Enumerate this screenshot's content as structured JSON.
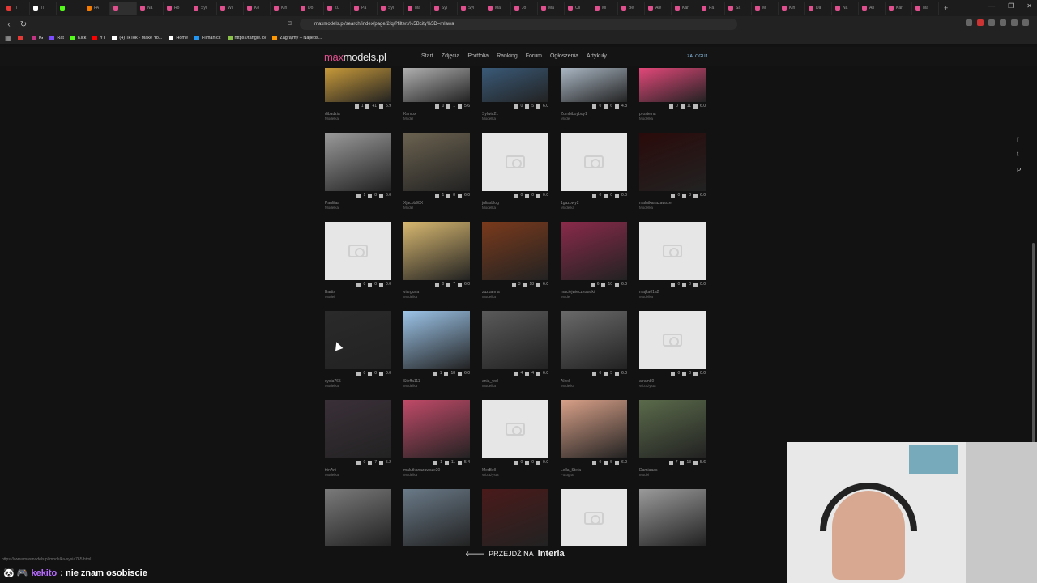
{
  "browser": {
    "tabs": [
      {
        "label": "Ti",
        "color": "#e53935"
      },
      {
        "label": "Ti",
        "color": "#ffffff"
      },
      {
        "label": "",
        "color": "#53fc18"
      },
      {
        "label": "FA",
        "color": "#f57c00"
      },
      {
        "label": "",
        "color": "#e04f8e",
        "active": true
      },
      {
        "label": "Na",
        "color": "#e04f8e"
      },
      {
        "label": "Ro",
        "color": "#e04f8e"
      },
      {
        "label": "Syl",
        "color": "#e04f8e"
      },
      {
        "label": "Wi",
        "color": "#e04f8e"
      },
      {
        "label": "Ko",
        "color": "#e04f8e"
      },
      {
        "label": "Kin",
        "color": "#e04f8e"
      },
      {
        "label": "Do",
        "color": "#e04f8e"
      },
      {
        "label": "Zu",
        "color": "#e04f8e"
      },
      {
        "label": "Pa",
        "color": "#e04f8e"
      },
      {
        "label": "Syl",
        "color": "#e04f8e"
      },
      {
        "label": "Ma",
        "color": "#e04f8e"
      },
      {
        "label": "Syl",
        "color": "#e04f8e"
      },
      {
        "label": "Syl",
        "color": "#e04f8e"
      },
      {
        "label": "Ma",
        "color": "#e04f8e"
      },
      {
        "label": "Jo",
        "color": "#e04f8e"
      },
      {
        "label": "Ma",
        "color": "#e04f8e"
      },
      {
        "label": "Oli",
        "color": "#e04f8e"
      },
      {
        "label": "Mi",
        "color": "#e04f8e"
      },
      {
        "label": "Be",
        "color": "#e04f8e"
      },
      {
        "label": "Ale",
        "color": "#e04f8e"
      },
      {
        "label": "Kar",
        "color": "#e04f8e"
      },
      {
        "label": "Pa",
        "color": "#e04f8e"
      },
      {
        "label": "Sa",
        "color": "#e04f8e"
      },
      {
        "label": "Mi",
        "color": "#e04f8e"
      },
      {
        "label": "Kin",
        "color": "#e04f8e"
      },
      {
        "label": "Da",
        "color": "#e04f8e"
      },
      {
        "label": "Na",
        "color": "#e04f8e"
      },
      {
        "label": "An",
        "color": "#e04f8e"
      },
      {
        "label": "Kar",
        "color": "#e04f8e"
      },
      {
        "label": "Ma",
        "color": "#e04f8e"
      }
    ],
    "new_tab": "+",
    "window_controls": [
      "—",
      "❐",
      "✕"
    ],
    "url": "maxmodels.pl/search/index/page/2/q/?filters%5Bcity%5D=mlawa",
    "bookmarks": [
      {
        "label": "",
        "color": "#e53935"
      },
      {
        "label": "IG",
        "color": "#c13584"
      },
      {
        "label": "Rat",
        "color": "#7c4dff"
      },
      {
        "label": "Kick",
        "color": "#53fc18"
      },
      {
        "label": "YT",
        "color": "#ff0000"
      },
      {
        "label": "(4)TikTok - Make Yo...",
        "color": "#ffffff"
      },
      {
        "label": "Home",
        "color": "#ffffff"
      },
      {
        "label": "Filman.cc",
        "color": "#2196f3"
      },
      {
        "label": "https://tangle.io/",
        "color": "#8bc34a"
      },
      {
        "label": "Zagrajmy – Najleps...",
        "color": "#ff9800"
      }
    ]
  },
  "site": {
    "logo_max": "max",
    "logo_rest": "models.pl",
    "menu": [
      "Start",
      "Zdjęcia",
      "Portfolia",
      "Ranking",
      "Forum",
      "Ogłoszenia",
      "Artykuły"
    ],
    "login": "ZALOGUJ"
  },
  "rows": [
    [
      {
        "name": "dibadzia",
        "role": "Modelka",
        "stats": [
          "1",
          "41",
          "5.9"
        ],
        "img": "#c89a3a"
      },
      {
        "name": "Kamox",
        "role": "Model",
        "stats": [
          "0",
          "1",
          "5.6"
        ],
        "img": "#b0b0b0"
      },
      {
        "name": "Sylwia21",
        "role": "Modelka",
        "stats": [
          "0",
          "5",
          "6.0"
        ],
        "img": "#3a5a78"
      },
      {
        "name": "Zombiboyboy1",
        "role": "Model",
        "stats": [
          "0",
          "6",
          "4.8"
        ],
        "img": "#aab7c4"
      },
      {
        "name": "prosteina",
        "role": "Modelka",
        "stats": [
          "0",
          "11",
          "6.0"
        ],
        "img": "#e2487a"
      }
    ],
    [
      {
        "name": "Paulitaa",
        "role": "Modelka",
        "stats": [
          "1",
          "8",
          "6.0"
        ],
        "img": "#9a9a9a"
      },
      {
        "name": "Xjacob98X",
        "role": "Model",
        "stats": [
          "1",
          "8",
          "6.0"
        ],
        "img": "#6b6250"
      },
      {
        "name": "juliasblog",
        "role": "Modelka",
        "stats": [
          "0",
          "0",
          "0.0"
        ],
        "img": ""
      },
      {
        "name": "1gazowy2",
        "role": "Modelka",
        "stats": [
          "0",
          "0",
          "0.0"
        ],
        "img": ""
      },
      {
        "name": "malutkanazawsze",
        "role": "Modelka",
        "stats": [
          "0",
          "3",
          "6.0"
        ],
        "img": "#2a0a0a"
      }
    ],
    [
      {
        "name": "Bartis",
        "role": "Model",
        "stats": [
          "0",
          "0",
          "0.0"
        ],
        "img": ""
      },
      {
        "name": "viarguria",
        "role": "Modelka",
        "stats": [
          "0",
          "7",
          "6.0"
        ],
        "img": "#d8b870"
      },
      {
        "name": "zuzuanna",
        "role": "Modelka",
        "stats": [
          "3",
          "18",
          "6.0"
        ],
        "img": "#7a3a1c"
      },
      {
        "name": "maciejwieczkowski",
        "role": "Model",
        "stats": [
          "6",
          "10",
          "6.0"
        ],
        "img": "#8a2a4a"
      },
      {
        "name": "majka01a2",
        "role": "Modelka",
        "stats": [
          "0",
          "0",
          "0.0"
        ],
        "img": ""
      }
    ],
    [
      {
        "name": "sysia765",
        "role": "Modelka",
        "stats": [
          "0",
          "0",
          "0.0"
        ],
        "img": "#2a2a2a"
      },
      {
        "name": "Steffa111",
        "role": "Modelka",
        "stats": [
          "1",
          "18",
          "6.0"
        ],
        "img": "#9cc4e8"
      },
      {
        "name": "ania_wel",
        "role": "Modelka",
        "stats": [
          "4",
          "4",
          "6.0"
        ],
        "img": "#5a5a5a"
      },
      {
        "name": "Alexl",
        "role": "Modelka",
        "stats": [
          "0",
          "5",
          "6.0"
        ],
        "img": "#6a6a6a"
      },
      {
        "name": "atram80",
        "role": "Wizażysta",
        "stats": [
          "0",
          "0",
          "0.0"
        ],
        "img": ""
      }
    ],
    [
      {
        "name": "trinAni",
        "role": "Modelka",
        "stats": [
          "0",
          "7",
          "5.2"
        ],
        "img": "#3a3038"
      },
      {
        "name": "malutkanazawsze20",
        "role": "Modelka",
        "stats": [
          "1",
          "11",
          "5.4"
        ],
        "img": "#c04a68"
      },
      {
        "name": "MerBell",
        "role": "Wizażysta",
        "stats": [
          "0",
          "0",
          "0.0"
        ],
        "img": ""
      },
      {
        "name": "Lella_Stefa",
        "role": "Fotograf",
        "stats": [
          "0",
          "5",
          "6.0"
        ],
        "img": "#d8a088"
      },
      {
        "name": "Damiaaas",
        "role": "Model",
        "stats": [
          "7",
          "13",
          "5.6"
        ],
        "img": "#5a6a4a"
      }
    ],
    [
      {
        "name": "",
        "role": "",
        "stats": [],
        "img": "#7a7a7a"
      },
      {
        "name": "",
        "role": "",
        "stats": [],
        "img": "#6a7a88"
      },
      {
        "name": "",
        "role": "",
        "stats": [],
        "img": "#4a1a1a"
      },
      {
        "name": "",
        "role": "",
        "stats": [],
        "img": ""
      },
      {
        "name": "",
        "role": "",
        "stats": [],
        "img": "#9a9a9a"
      }
    ]
  ],
  "share_icons": [
    "f",
    "t",
    "P"
  ],
  "banner": {
    "arrow": "🡐",
    "text": "PRZEJDŹ NA",
    "brand": "interia"
  },
  "status_url": "https://www.maxmodels.pl/modelka-sysia765.html",
  "chat": {
    "badges": "🐼 🎮",
    "user": "kekito",
    "message": ": nie znam osobiscie"
  }
}
